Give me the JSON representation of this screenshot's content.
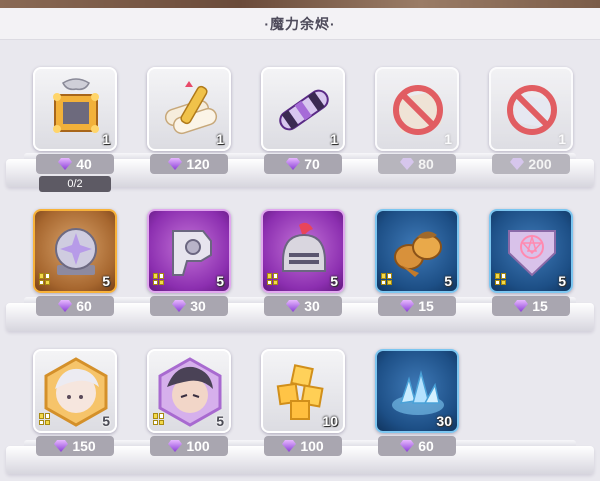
{
  "header": {
    "title": "·魔力余烬·"
  },
  "shop": {
    "items": [
      {
        "name": "gold-frame-item",
        "count": "1",
        "price": "40",
        "limit": "0/2"
      },
      {
        "name": "scroll-bundle",
        "count": "1",
        "price": "120"
      },
      {
        "name": "purple-scroll",
        "count": "1",
        "price": "70"
      },
      {
        "name": "sold-out-item-1",
        "count": "1",
        "price": "80"
      },
      {
        "name": "sold-out-item-2",
        "count": "1",
        "price": "200"
      },
      {
        "name": "rune-stone",
        "count": "5",
        "price": "60"
      },
      {
        "name": "gauntlet-gear",
        "count": "5",
        "price": "30"
      },
      {
        "name": "knight-helmet",
        "count": "5",
        "price": "30"
      },
      {
        "name": "acorn-charm",
        "count": "5",
        "price": "15"
      },
      {
        "name": "pentagon-emblem",
        "count": "5",
        "price": "15"
      },
      {
        "name": "white-hair-portrait",
        "count": "5",
        "price": "150"
      },
      {
        "name": "dark-hair-portrait",
        "count": "5",
        "price": "100"
      },
      {
        "name": "gold-cube-cluster",
        "count": "10",
        "price": "100"
      },
      {
        "name": "blue-crystal-pile",
        "count": "30",
        "price": "60"
      }
    ]
  }
}
